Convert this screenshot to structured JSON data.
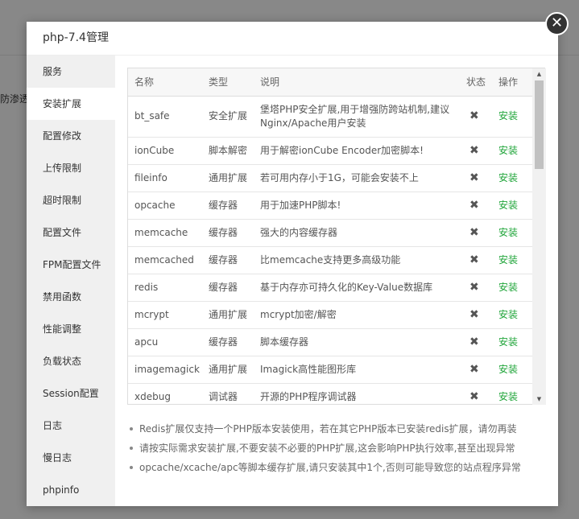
{
  "background": {
    "partial_text": "防渗透"
  },
  "dialog": {
    "title": "php-7.4管理",
    "close_icon": "close-icon"
  },
  "sidebar": {
    "items": [
      {
        "label": "服务",
        "active": false
      },
      {
        "label": "安装扩展",
        "active": true
      },
      {
        "label": "配置修改",
        "active": false
      },
      {
        "label": "上传限制",
        "active": false
      },
      {
        "label": "超时限制",
        "active": false
      },
      {
        "label": "配置文件",
        "active": false
      },
      {
        "label": "FPM配置文件",
        "active": false
      },
      {
        "label": "禁用函数",
        "active": false
      },
      {
        "label": "性能调整",
        "active": false
      },
      {
        "label": "负载状态",
        "active": false
      },
      {
        "label": "Session配置",
        "active": false
      },
      {
        "label": "日志",
        "active": false
      },
      {
        "label": "慢日志",
        "active": false
      },
      {
        "label": "phpinfo",
        "active": false
      }
    ]
  },
  "table": {
    "headers": [
      "名称",
      "类型",
      "说明",
      "状态",
      "操作"
    ],
    "rows": [
      {
        "name": "bt_safe",
        "type": "安全扩展",
        "desc": "堡塔PHP安全扩展,用于增强防跨站机制,建议Nginx/Apache用户安装",
        "status": "✖",
        "action": "安装"
      },
      {
        "name": "ionCube",
        "type": "脚本解密",
        "desc": "用于解密ionCube Encoder加密脚本!",
        "status": "✖",
        "action": "安装"
      },
      {
        "name": "fileinfo",
        "type": "通用扩展",
        "desc": "若可用内存小于1G，可能会安装不上",
        "status": "✖",
        "action": "安装"
      },
      {
        "name": "opcache",
        "type": "缓存器",
        "desc": "用于加速PHP脚本!",
        "status": "✖",
        "action": "安装"
      },
      {
        "name": "memcache",
        "type": "缓存器",
        "desc": "强大的内容缓存器",
        "status": "✖",
        "action": "安装"
      },
      {
        "name": "memcached",
        "type": "缓存器",
        "desc": "比memcache支持更多高级功能",
        "status": "✖",
        "action": "安装"
      },
      {
        "name": "redis",
        "type": "缓存器",
        "desc": "基于内存亦可持久化的Key-Value数据库",
        "status": "✖",
        "action": "安装"
      },
      {
        "name": "mcrypt",
        "type": "通用扩展",
        "desc": "mcrypt加密/解密",
        "status": "✖",
        "action": "安装"
      },
      {
        "name": "apcu",
        "type": "缓存器",
        "desc": "脚本缓存器",
        "status": "✖",
        "action": "安装"
      },
      {
        "name": "imagemagick",
        "type": "通用扩展",
        "desc": "Imagick高性能图形库",
        "status": "✖",
        "action": "安装"
      },
      {
        "name": "xdebug",
        "type": "调试器",
        "desc": "开源的PHP程序调试器",
        "status": "✖",
        "action": "安装"
      }
    ]
  },
  "notes": [
    "Redis扩展仅支持一个PHP版本安装使用，若在其它PHP版本已安装redis扩展，请勿再装",
    "请按实际需求安装扩展,不要安装不必要的PHP扩展,这会影响PHP执行效率,甚至出现异常",
    "opcache/xcache/apc等脚本缓存扩展,请只安装其中1个,否则可能导致您的站点程序异常"
  ],
  "colors": {
    "accent_green": "#20a53a",
    "sidebar_bg": "#f0f0f0"
  }
}
